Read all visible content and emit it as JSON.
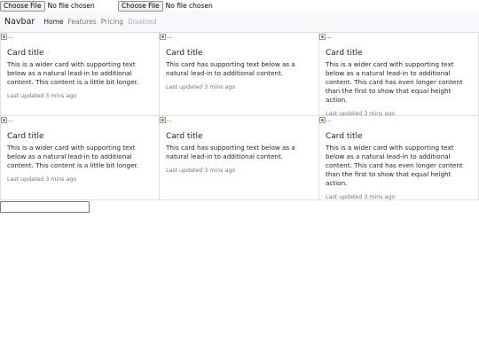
{
  "file_inputs": [
    {
      "button": "Choose File",
      "status": "No file chosen"
    },
    {
      "button": "Choose File",
      "status": "No file chosen"
    }
  ],
  "navbar": {
    "brand": "Navbar",
    "links": [
      "Home",
      "Features",
      "Pricing",
      "Disabled"
    ]
  },
  "cards": [
    {
      "alt": "...",
      "title": "Card title",
      "text": "This is a wider card with supporting text below as a natural lead-in to additional content. This content is a little bit longer.",
      "updated": "Last updated 3 mins ago"
    },
    {
      "alt": "...",
      "title": "Card title",
      "text": "This card has supporting text below as a natural lead-in to additional content.",
      "updated": "Last updated 3 mins ago"
    },
    {
      "alt": "...",
      "title": "Card title",
      "text": "This is a wider card with supporting text below as a natural lead-in to additional content. This card has even longer content than the first to show that equal height action.",
      "updated": "Last updated 3 mins ago"
    },
    {
      "alt": "...",
      "title": "Card title",
      "text": "This is a wider card with supporting text below as a natural lead-in to additional content. This content is a little bit longer.",
      "updated": "Last updated 3 mins ago"
    },
    {
      "alt": "...",
      "title": "Card title",
      "text": "This card has supporting text below as a natural lead-in to additional content.",
      "updated": "Last updated 3 mins ago"
    },
    {
      "alt": "...",
      "title": "Card title",
      "text": "This is a wider card with supporting text below as a natural lead-in to additional content. This card has even longer content than the first to show that equal height action.",
      "updated": "Last updated 3 mins ago"
    }
  ],
  "bottom_input": {
    "value": ""
  }
}
